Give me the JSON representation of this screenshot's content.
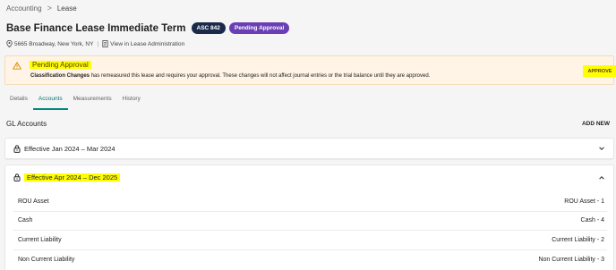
{
  "breadcrumb": {
    "parent": "Accounting",
    "separator": ">",
    "current": "Lease"
  },
  "header": {
    "title": "Base Finance Lease Immediate Term",
    "badges": {
      "asc": "ASC 842",
      "status": "Pending Approval"
    },
    "address": "5665 Broadway, New York, NY",
    "separator": "|",
    "view_link": "View in Lease Administration"
  },
  "alert": {
    "title": "Pending Approval",
    "desc_bold": "Classification Changes",
    "desc_rest": " has remeasured this lease and requires your approval. These changes will not affect journal entries or the trial balance until they are approved.",
    "approve_label": "APPROVE"
  },
  "tabs": [
    {
      "label": "Details",
      "active": false
    },
    {
      "label": "Accounts",
      "active": true
    },
    {
      "label": "Measurements",
      "active": false
    },
    {
      "label": "History",
      "active": false
    }
  ],
  "gl": {
    "title": "GL Accounts",
    "add_new": "ADD NEW"
  },
  "periods": [
    {
      "label": "Effective Jan 2024 – Mar 2024",
      "expanded": false
    },
    {
      "label": "Effective Apr 2024 – Dec 2025",
      "expanded": true,
      "rows": [
        {
          "name": "ROU Asset",
          "value": "ROU Asset - 1"
        },
        {
          "name": "Cash",
          "value": "Cash - 4"
        },
        {
          "name": "Current Liability",
          "value": "Current Liability - 2"
        },
        {
          "name": "Non Current Liability",
          "value": "Non Current Liability - 3"
        }
      ]
    }
  ],
  "colors": {
    "accent": "#00897b",
    "asc_badge": "#1b2a4a",
    "pending_badge": "#6a3fb5",
    "alert_bg": "#fff4e5",
    "highlight": "#ffff00"
  }
}
